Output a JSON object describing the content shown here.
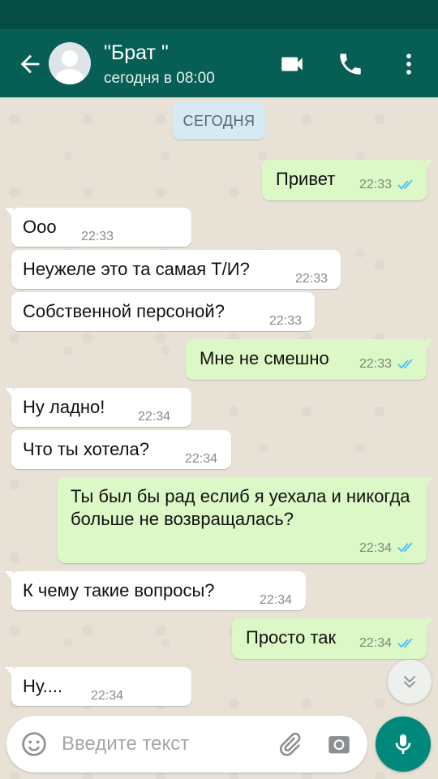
{
  "header": {
    "title": "\"Брат \"",
    "subtitle": "сегодня в 08:00"
  },
  "chat": {
    "date_divider": "СЕГОДНЯ",
    "messages": [
      {
        "dir": "out",
        "text": "Привет",
        "time": "22:33",
        "status": "read"
      },
      {
        "dir": "in",
        "text": "Ооо",
        "time": "22:33"
      },
      {
        "dir": "in",
        "text": "Неужеле это та самая Т/И?",
        "time": "22:33"
      },
      {
        "dir": "in",
        "text": "Собственной персоной?",
        "time": "22:33"
      },
      {
        "dir": "out",
        "text": "Мне не смешно",
        "time": "22:33",
        "status": "read"
      },
      {
        "dir": "in",
        "text": "Ну ладно!",
        "time": "22:34"
      },
      {
        "dir": "in",
        "text": "Что ты хотела?",
        "time": "22:34"
      },
      {
        "dir": "out",
        "text": "Ты был бы рад еслиб я уехала и никогда больше не возвращалась?",
        "time": "22:34",
        "status": "read"
      },
      {
        "dir": "in",
        "text": "К чему такие вопросы?",
        "time": "22:34"
      },
      {
        "dir": "out",
        "text": "Просто так",
        "time": "22:34",
        "status": "read"
      },
      {
        "dir": "in",
        "text": "Ну....",
        "time": "22:34"
      }
    ]
  },
  "composer": {
    "placeholder": "Введите текст"
  },
  "colors": {
    "header": "#075e54",
    "status_bar": "#054d44",
    "outgoing_bubble": "#dcf8c6",
    "incoming_bubble": "#ffffff",
    "read_ticks": "#4fc3f7",
    "mic_button": "#00897b"
  },
  "icons": [
    "back-arrow-icon",
    "avatar-icon",
    "video-call-icon",
    "phone-icon",
    "more-vert-icon",
    "double-check-icon",
    "chevron-double-down-icon",
    "emoji-icon",
    "attach-icon",
    "camera-icon",
    "mic-icon"
  ]
}
